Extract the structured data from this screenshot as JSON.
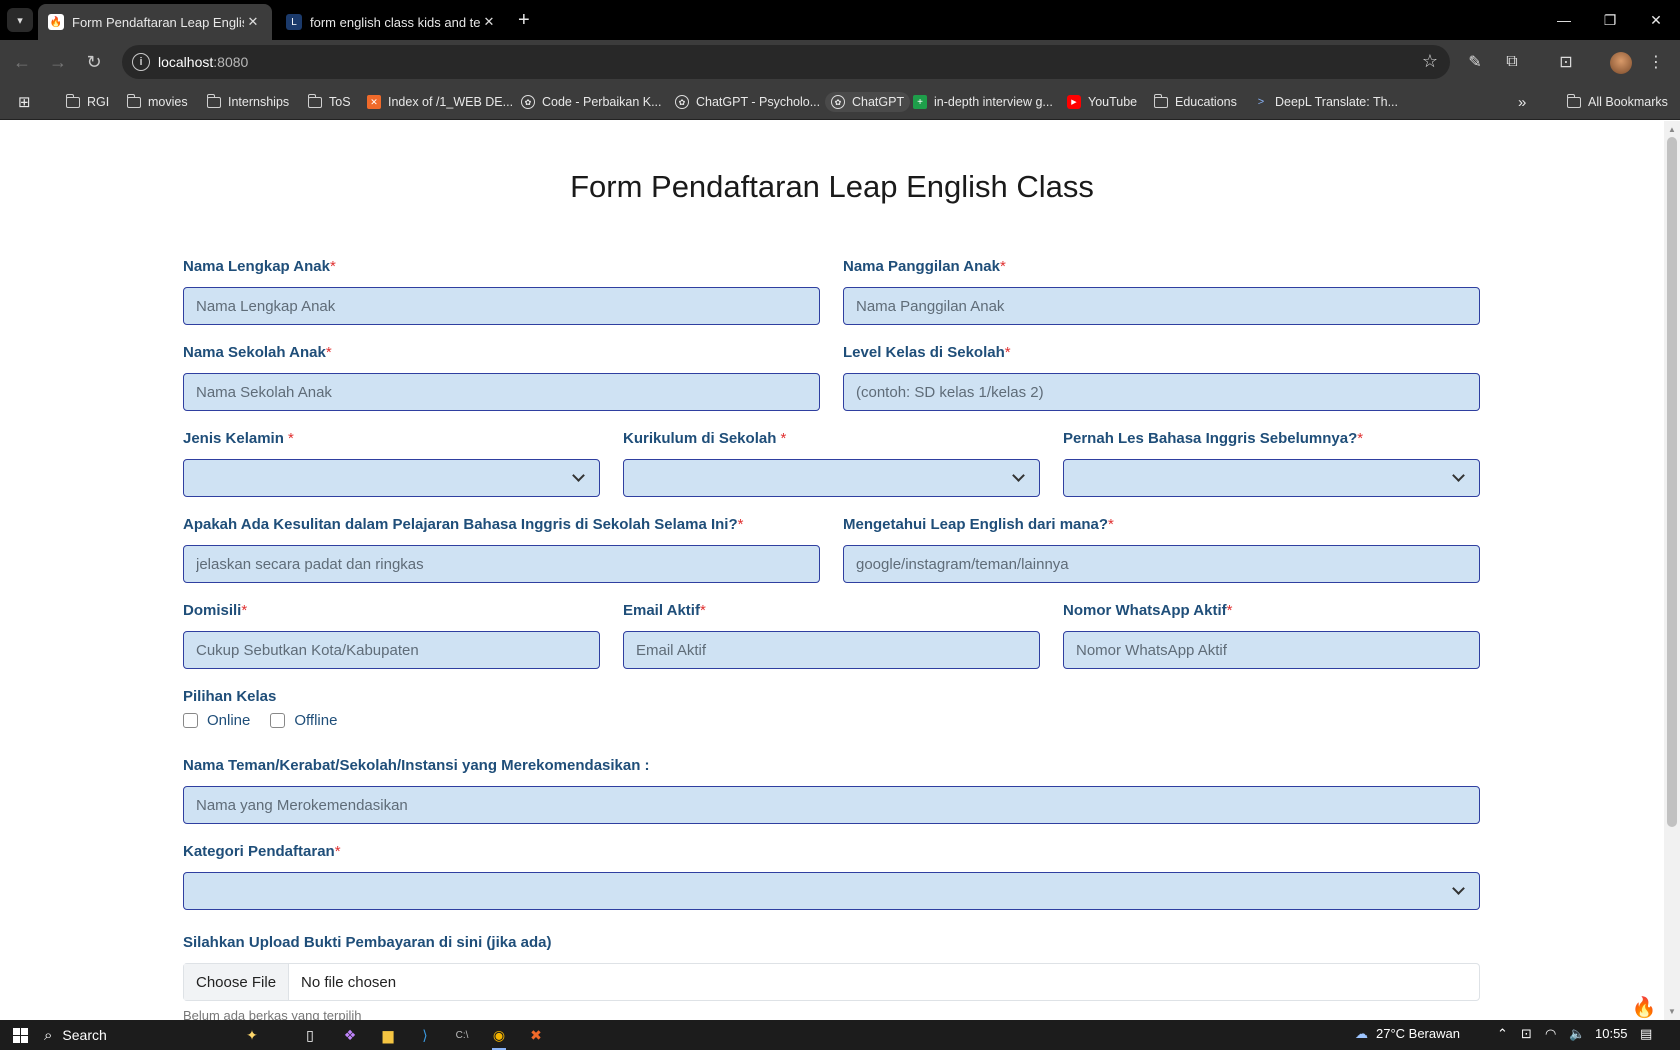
{
  "browser": {
    "tabs": [
      {
        "title": "Form Pendaftaran Leap English",
        "active": true,
        "favicon": "fire-icon"
      },
      {
        "title": "form english class kids and teen",
        "active": false,
        "favicon": "site-icon"
      }
    ],
    "address": {
      "host": "localhost",
      "port": ":8080"
    },
    "bookmarks": [
      {
        "label": "RGI",
        "icon": "folder-icon"
      },
      {
        "label": "movies",
        "icon": "folder-icon"
      },
      {
        "label": "Internships",
        "icon": "folder-icon"
      },
      {
        "label": "ToS",
        "icon": "folder-icon"
      },
      {
        "label": "Index of /1_WEB DE...",
        "icon": "xampp-icon"
      },
      {
        "label": "Code - Perbaikan K...",
        "icon": "chatgpt-icon"
      },
      {
        "label": "ChatGPT - Psycholo...",
        "icon": "chatgpt-icon"
      },
      {
        "label": "ChatGPT",
        "icon": "chatgpt-icon"
      },
      {
        "label": "in-depth interview g...",
        "icon": "sheets-icon"
      },
      {
        "label": "YouTube",
        "icon": "youtube-icon"
      },
      {
        "label": "Educations",
        "icon": "folder-icon"
      },
      {
        "label": "DeepL Translate: Th...",
        "icon": "deepl-icon"
      }
    ],
    "all_bookmarks": "All Bookmarks"
  },
  "form": {
    "title": "Form Pendaftaran Leap English Class",
    "fields": {
      "nama_lengkap": {
        "label": "Nama Lengkap Anak",
        "placeholder": "Nama Lengkap Anak"
      },
      "nama_panggilan": {
        "label": "Nama Panggilan Anak",
        "placeholder": "Nama Panggilan Anak"
      },
      "nama_sekolah": {
        "label": "Nama Sekolah Anak",
        "placeholder": "Nama Sekolah Anak"
      },
      "level_kelas": {
        "label": "Level Kelas di Sekolah",
        "placeholder": "(contoh: SD kelas 1/kelas 2)"
      },
      "jenis_kelamin": {
        "label": "Jenis Kelamin ",
        "value": ""
      },
      "kurikulum": {
        "label": "Kurikulum di Sekolah ",
        "value": ""
      },
      "pernah_les": {
        "label": "Pernah Les Bahasa Inggris Sebelumnya?",
        "value": ""
      },
      "kesulitan": {
        "label": "Apakah Ada Kesulitan dalam Pelajaran Bahasa Inggris di Sekolah Selama Ini?",
        "placeholder": "jelaskan secara padat dan ringkas"
      },
      "sumber_info": {
        "label": "Mengetahui Leap English dari mana?",
        "placeholder": "google/instagram/teman/lainnya"
      },
      "domisili": {
        "label": "Domisili",
        "placeholder": "Cukup Sebutkan Kota/Kabupaten"
      },
      "email": {
        "label": "Email Aktif",
        "placeholder": "Email Aktif"
      },
      "whatsapp": {
        "label": "Nomor WhatsApp Aktif",
        "placeholder": "Nomor WhatsApp Aktif"
      },
      "pilihan_kelas": {
        "label": "Pilihan Kelas",
        "options": [
          "Online",
          "Offline"
        ]
      },
      "rekomendasi": {
        "label": "Nama Teman/Kerabat/Sekolah/Instansi yang Merekomendasikan :",
        "placeholder": "Nama yang Merokemendasikan"
      },
      "kategori": {
        "label": "Kategori Pendaftaran",
        "value": ""
      },
      "upload": {
        "label": "Silahkan Upload Bukti Pembayaran di sini (jika ada)",
        "button": "Choose File",
        "status": "No file chosen",
        "hint": "Belum ada berkas yang terpilih"
      }
    },
    "required_mark": "*",
    "accent_color": "#1f4e79",
    "field_bg": "#cfe2f3"
  },
  "taskbar": {
    "search": "Search",
    "weather": "27°C  Berawan",
    "time": "10:55"
  }
}
